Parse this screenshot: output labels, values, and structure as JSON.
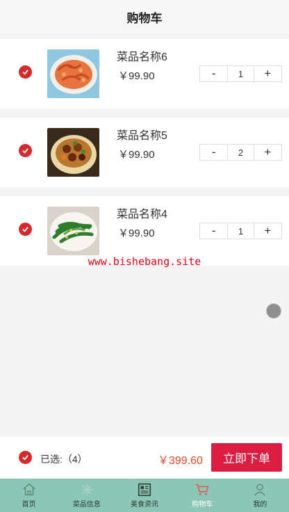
{
  "header": {
    "title": "购物车"
  },
  "cart": {
    "items": [
      {
        "name": "菜品名称6",
        "price": "￥99.90",
        "minus": "-",
        "qty": "1",
        "plus": "+",
        "checked": true
      },
      {
        "name": "菜品名称5",
        "price": "￥99.90",
        "minus": "-",
        "qty": "2",
        "plus": "+",
        "checked": true
      },
      {
        "name": "菜品名称4",
        "price": "￥99.90",
        "minus": "-",
        "qty": "1",
        "plus": "+",
        "checked": true
      }
    ]
  },
  "watermark": "www.bishebang.site",
  "checkout": {
    "selected_label": "已选:（4）",
    "total": "￥399.60",
    "order_button": "立即下单"
  },
  "tabbar": {
    "items": [
      {
        "label": "首页",
        "icon": "home-icon"
      },
      {
        "label": "菜品信息",
        "icon": "dish-icon"
      },
      {
        "label": "美食资讯",
        "icon": "news-icon"
      },
      {
        "label": "购物车",
        "icon": "cart-icon",
        "active": true
      },
      {
        "label": "我的",
        "icon": "user-icon"
      }
    ]
  },
  "colors": {
    "accent": "#d7282a",
    "order_button": "#dc1d42",
    "price_total": "#e24a2a",
    "tabbar": "#8cc6b4"
  }
}
